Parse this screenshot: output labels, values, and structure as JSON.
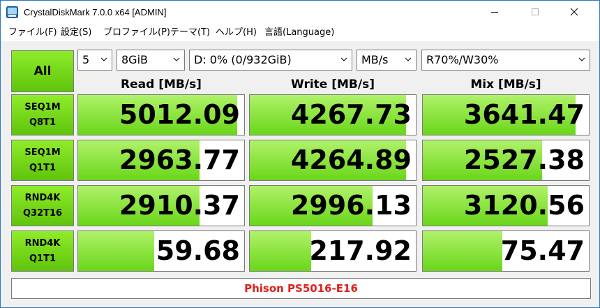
{
  "window": {
    "title": "CrystalDiskMark 7.0.0 x64 [ADMIN]",
    "accent_color": "#2b78c2"
  },
  "menu": [
    "ファイル(F)",
    "設定(S)",
    "プロファイル(P)",
    "テーマ(T)",
    "ヘルプ(H)",
    "言語(Language)"
  ],
  "controls": {
    "all_label": "All",
    "count": "5",
    "size": "8GiB",
    "drive": "D: 0% (0/932GiB)",
    "unit": "MB/s",
    "mix_ratio": "R70%/W30%"
  },
  "columns": {
    "read": "Read [MB/s]",
    "write": "Write [MB/s]",
    "mix": "Mix [MB/s]"
  },
  "rows": [
    {
      "line1": "SEQ1M",
      "line2": "Q8T1",
      "read": {
        "value": "5012.09",
        "level": 0.96
      },
      "write": {
        "value": "4267.73",
        "level": 0.94
      },
      "mix": {
        "value": "3641.47",
        "level": 0.92
      }
    },
    {
      "line1": "SEQ1M",
      "line2": "Q1T1",
      "read": {
        "value": "2963.77",
        "level": 0.73
      },
      "write": {
        "value": "4264.89",
        "level": 0.94
      },
      "mix": {
        "value": "2527.38",
        "level": 0.72
      }
    },
    {
      "line1": "RND4K",
      "line2": "Q32T16",
      "read": {
        "value": "2910.37",
        "level": 0.73
      },
      "write": {
        "value": "2996.13",
        "level": 0.74
      },
      "mix": {
        "value": "3120.56",
        "level": 0.75
      }
    },
    {
      "line1": "RND4K",
      "line2": "Q1T1",
      "read": {
        "value": "59.68",
        "level": 0.46
      },
      "write": {
        "value": "217.92",
        "level": 0.37
      },
      "mix": {
        "value": "75.47",
        "level": 0.48
      }
    }
  ],
  "footer": {
    "comment": "Phison PS5016-E16",
    "comment_color": "#e0201a"
  },
  "colors": {
    "button_green": "#6ad61a",
    "bar_green": "#8fe84a"
  }
}
